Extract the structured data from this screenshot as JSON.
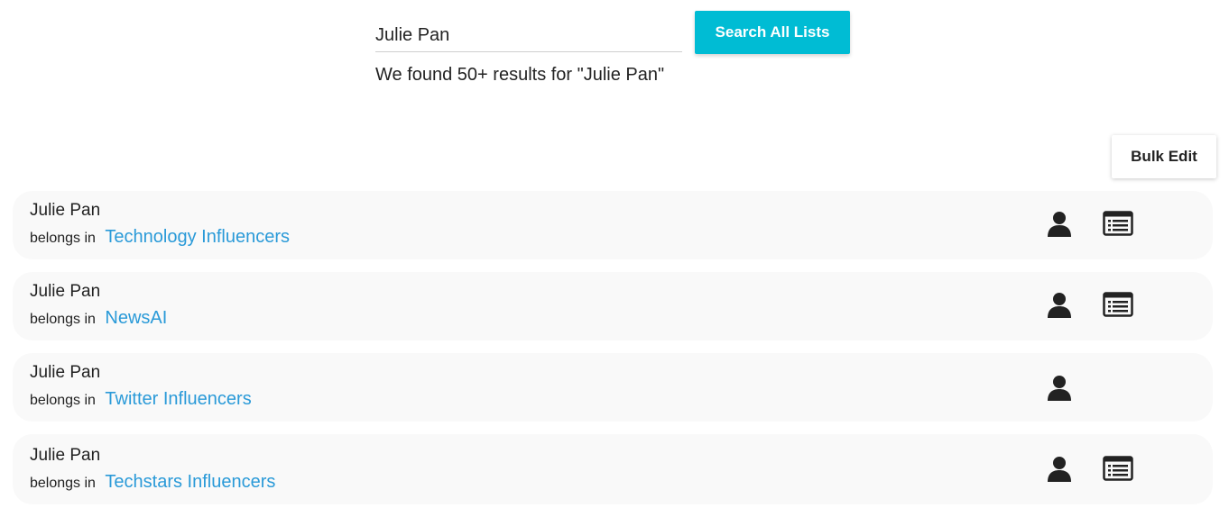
{
  "search": {
    "value": "Julie Pan",
    "button_label": "Search All Lists"
  },
  "summary": "We found 50+ results for \"Julie Pan\"",
  "bulk_edit_label": "Bulk Edit",
  "belongs_label": "belongs in",
  "results": [
    {
      "name": "Julie Pan",
      "list": "Technology Influencers",
      "has_list_icon": true
    },
    {
      "name": "Julie Pan",
      "list": "NewsAI",
      "has_list_icon": true
    },
    {
      "name": "Julie Pan",
      "list": "Twitter Influencers",
      "has_list_icon": false
    },
    {
      "name": "Julie Pan",
      "list": "Techstars Influencers",
      "has_list_icon": true
    }
  ],
  "colors": {
    "accent": "#00bcd4",
    "link": "#2a9ad8",
    "row_background": "#f9f9f9"
  },
  "icons": {
    "contact": "person-icon",
    "list": "list-view-icon"
  }
}
